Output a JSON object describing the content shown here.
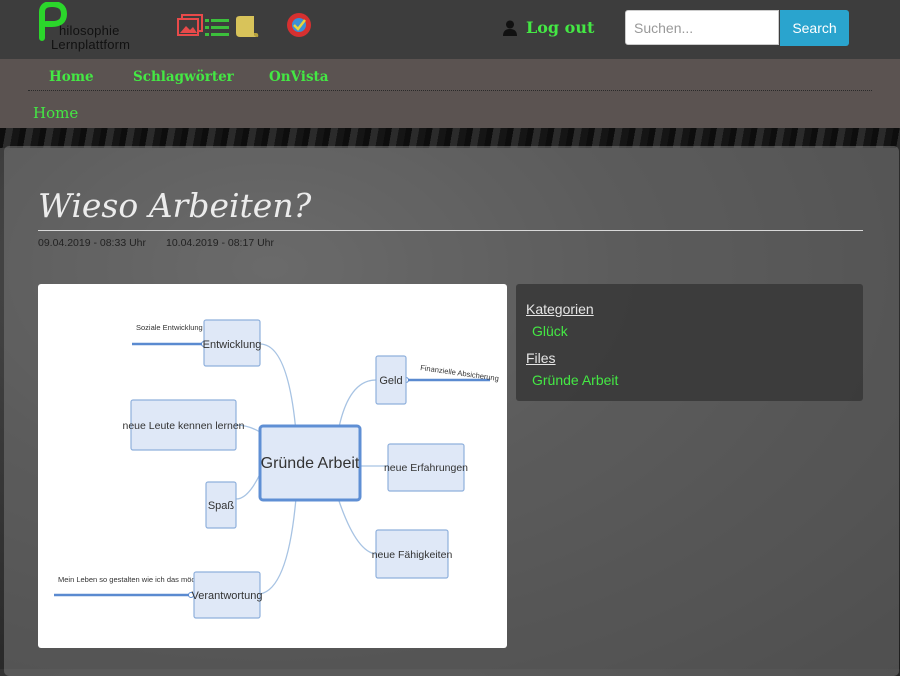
{
  "header": {
    "logo_line1": "hilosophie",
    "logo_line2": "Lernplattform",
    "logout_label": "Log out",
    "search_placeholder": "Suchen...",
    "search_button": "Search",
    "tool_icons": [
      "gallery-icon",
      "list-icon",
      "scroll-icon",
      "badge-icon"
    ]
  },
  "nav": {
    "items": [
      "Home",
      "Schlagwörter",
      "OnVista"
    ]
  },
  "breadcrumb": "Home",
  "article": {
    "title": "Wieso Arbeiten?",
    "created": "09.04.2019 - 08:33 Uhr",
    "updated": "10.04.2019 - 08:17 Uhr"
  },
  "mindmap": {
    "center": "Gründe Arbeit",
    "left_nodes": [
      "Entwicklung",
      "neue Leute kennen lernen",
      "Spaß",
      "Verantwortung"
    ],
    "right_nodes": [
      "Geld",
      "neue Erfahrungen",
      "neue Fähigkeiten"
    ],
    "notes": {
      "entwicklung": "Soziale Entwicklung",
      "geld": "Finanzielle Absicherung",
      "verantwortung": "Mein Leben so gestalten wie ich das möchte"
    }
  },
  "sidebar": {
    "categories_heading": "Kategorien",
    "category": "Glück",
    "files_heading": "Files",
    "file": "Gründe Arbeit"
  },
  "colors": {
    "accent_green": "#44e844",
    "search_blue": "#2aa4ce",
    "topbar": "#3d3d3d",
    "navbar": "#5b5351"
  }
}
